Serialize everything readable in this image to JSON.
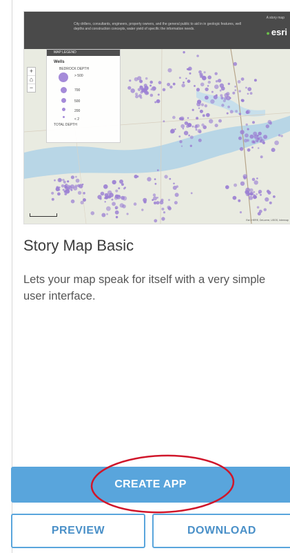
{
  "card": {
    "title": "Story Map Basic",
    "description": "Lets your map speak for itself with a very simple user interface."
  },
  "thumbnail": {
    "header_text": "City drillers, consultants, engineers, property owners, and the general public to aid in in geologic features, well depths and construction concepts, water yield of specific the information needs.",
    "tagline": "A story map",
    "logo": "esri",
    "legend": {
      "header": "MAP LEGEND",
      "title": "Wells",
      "subtitle": "BEDROCK DEPTH",
      "rows": [
        {
          "label": "> 500",
          "size": 14
        },
        {
          "label": "700",
          "size": 9
        },
        {
          "label": "500",
          "size": 7
        },
        {
          "label": "200",
          "size": 5
        },
        {
          "label": "< 2",
          "size": 3
        }
      ],
      "total": "TOTAL DEPTH"
    },
    "zoom": {
      "plus": "+",
      "home": "⌂",
      "minus": "−"
    },
    "attribution": "Esri, HERE, DeLorme, USGS, Intermap"
  },
  "actions": {
    "create": "CREATE APP",
    "preview": "PREVIEW",
    "download": "DOWNLOAD"
  },
  "colors": {
    "accent": "#59a5dc",
    "annotation": "#d0162a",
    "map_dots": "#9b80d3",
    "lake": "#b8d6e6"
  }
}
